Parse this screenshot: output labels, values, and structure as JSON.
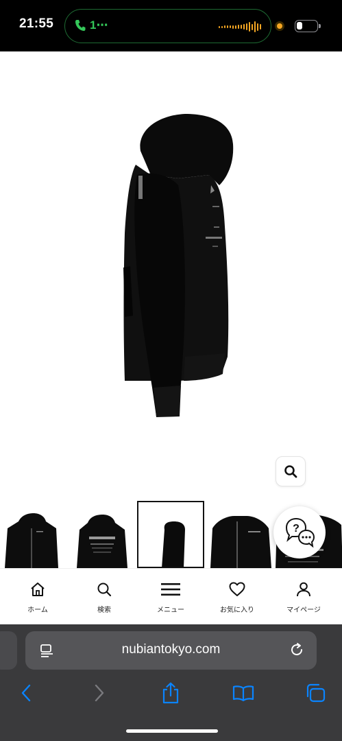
{
  "status_bar": {
    "time": "21:55",
    "call_indicator": "1⋯",
    "call_color": "#34c759",
    "audio_color": "#f5a623",
    "battery_level": 0.3
  },
  "product": {
    "image_description_icon": "hoodie-side-view-image",
    "zoom_icon": "magnifier-icon"
  },
  "thumbnails": [
    {
      "name": "thumbnail-front",
      "selected": false
    },
    {
      "name": "thumbnail-back",
      "selected": false
    },
    {
      "name": "thumbnail-side",
      "selected": true
    },
    {
      "name": "thumbnail-front-closeup",
      "selected": false
    },
    {
      "name": "thumbnail-back-closeup",
      "selected": false
    }
  ],
  "chat": {
    "icon": "chat-bubble-icon"
  },
  "bottom_nav": {
    "items": [
      {
        "label": "ホーム",
        "icon": "home-icon"
      },
      {
        "label": "検索",
        "icon": "search-icon"
      },
      {
        "label": "メニュー",
        "icon": "menu-icon"
      },
      {
        "label": "お気に入り",
        "icon": "heart-icon"
      },
      {
        "label": "マイページ",
        "icon": "user-icon"
      }
    ]
  },
  "safari": {
    "url": "nubiantokyo.com",
    "accent_color": "#0a84ff"
  }
}
